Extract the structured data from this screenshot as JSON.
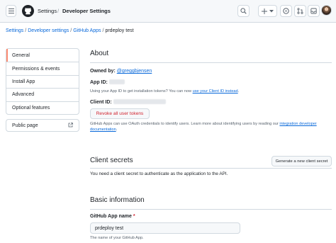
{
  "header": {
    "crumb_settings": "Settings",
    "separator": "/",
    "crumb_developer": "Developer Settings",
    "icons": [
      "menu-icon",
      "github-logo",
      "search-icon",
      "plus-icon",
      "triangle-down-icon",
      "issue-icon",
      "pull-request-icon",
      "inbox-icon",
      "avatar"
    ]
  },
  "breadcrumb": {
    "items": [
      "Settings",
      "Developer settings",
      "GitHub Apps"
    ],
    "current": "prdeploy test",
    "separator": "/"
  },
  "sidebar": {
    "items": [
      {
        "label": "General",
        "selected": true
      },
      {
        "label": "Permissions & events",
        "selected": false
      },
      {
        "label": "Install App",
        "selected": false
      },
      {
        "label": "Advanced",
        "selected": false
      },
      {
        "label": "Optional features",
        "selected": false
      }
    ],
    "public_page": "Public page"
  },
  "about": {
    "title": "About",
    "owned_by_label": "Owned by:",
    "owner": "@greggbjensen",
    "app_id_label": "App ID:",
    "app_id_hint_prefix": "Using your App ID to get installation tokens? You can now",
    "app_id_hint_link": "use your Client ID instead",
    "app_id_hint_suffix": ".",
    "client_id_label": "Client ID:",
    "revoke_button": "Revoke all user tokens",
    "oauth_text_prefix": "GitHub Apps can use OAuth credentials to identify users. Learn more about identifying users by reading our",
    "oauth_link": "integration developer",
    "oauth_link2": "documentation",
    "oauth_suffix": "."
  },
  "client_secrets": {
    "title": "Client secrets",
    "generate_button": "Generate a new client secret",
    "description": "You need a client secret to authenticate as the application to the API."
  },
  "basic_info": {
    "title": "Basic information",
    "app_name_label": "GitHub App name",
    "required_mark": "*",
    "app_name_value": "prdeploy test",
    "app_name_hint": "The name of your GitHub App."
  },
  "colors": {
    "link": "#0969da",
    "danger": "#d1242f",
    "selected_accent": "#fd8c73",
    "border": "#d1d9e0"
  }
}
